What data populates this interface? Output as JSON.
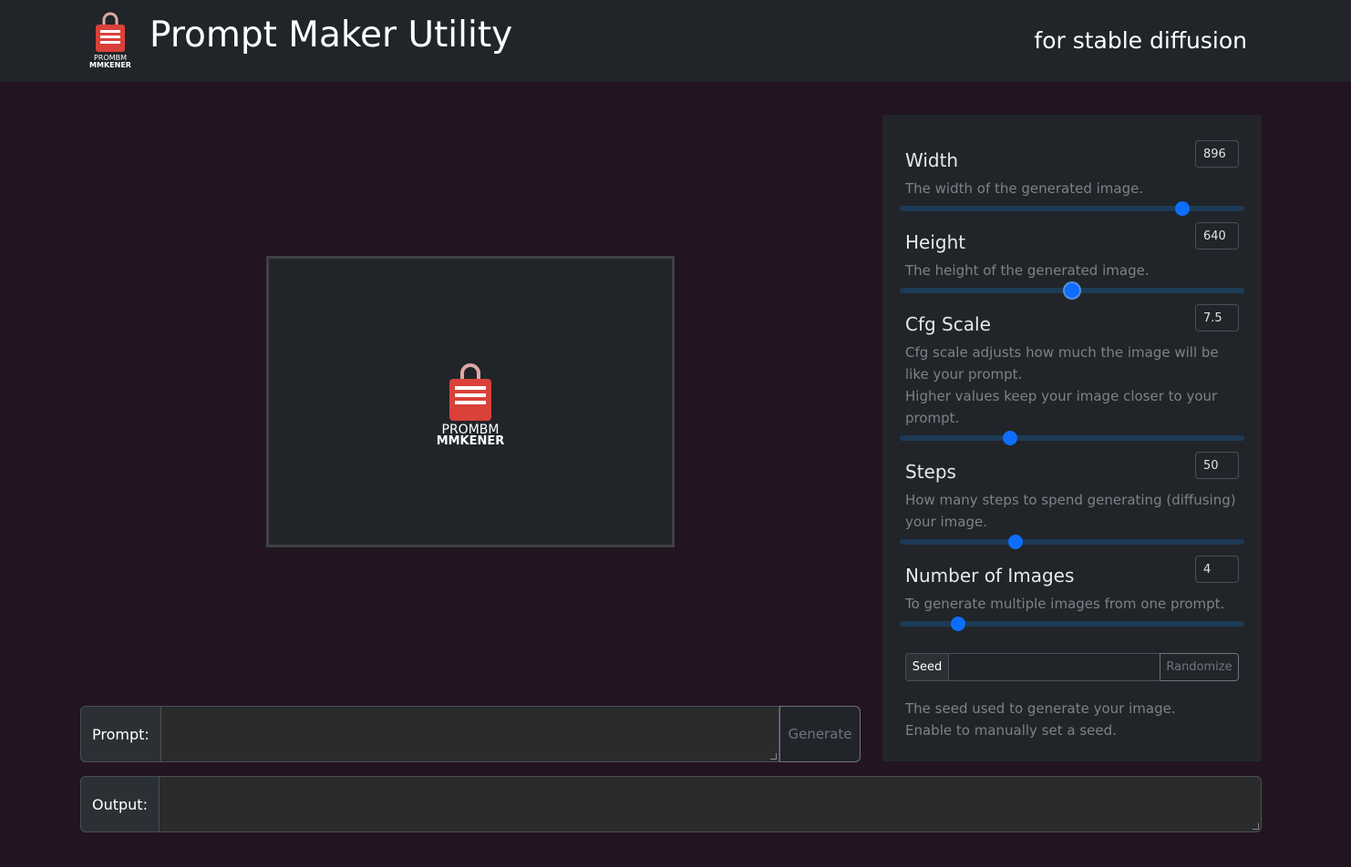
{
  "header": {
    "title": "Prompt Maker Utility",
    "subtitle": "for stable diffusion",
    "logo_text_top": "PROMBM",
    "logo_text_bottom": "MMKENER"
  },
  "preview": {
    "logo_text_top": "PROMBM",
    "logo_text_bottom": "MMKENER"
  },
  "settings": {
    "width": {
      "title": "Width",
      "value": "896",
      "desc": "The width of the generated image.",
      "slider_fraction": 0.82
    },
    "height": {
      "title": "Height",
      "value": "640",
      "desc": "The height of the generated image.",
      "slider_fraction": 0.5
    },
    "cfg": {
      "title": "Cfg Scale",
      "value": "7.5",
      "desc_line1": "Cfg scale adjusts how much the image will be like your prompt.",
      "desc_line2": "Higher values keep your image closer to your prompt.",
      "slider_fraction": 0.32
    },
    "steps": {
      "title": "Steps",
      "value": "50",
      "desc": "How many steps to spend generating (diffusing) your image.",
      "slider_fraction": 0.335
    },
    "num_images": {
      "title": "Number of Images",
      "value": "4",
      "desc": "To generate multiple images from one prompt.",
      "slider_fraction": 0.17
    },
    "seed": {
      "label": "Seed",
      "value": "",
      "button": "Randomize",
      "desc_line1": "The seed used to generate your image.",
      "desc_line2": "Enable to manually set a seed."
    }
  },
  "prompt": {
    "label": "Prompt:",
    "value": "",
    "button": "Generate"
  },
  "output": {
    "label": "Output:",
    "value": ""
  },
  "colors": {
    "accent": "#0d6efd",
    "logo_red": "#d9413a",
    "page_bg": "#231421"
  }
}
